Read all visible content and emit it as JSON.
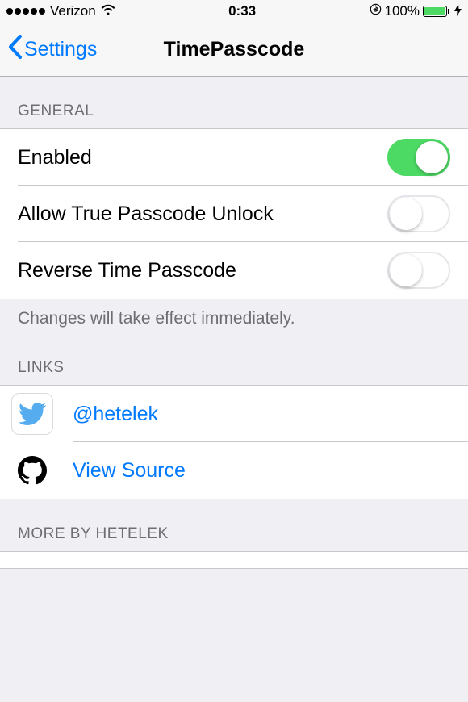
{
  "status_bar": {
    "carrier": "Verizon",
    "time": "0:33",
    "battery_percent": "100%"
  },
  "nav": {
    "back_label": "Settings",
    "title": "TimePasscode"
  },
  "sections": {
    "general": {
      "header": "GENERAL",
      "rows": {
        "enabled": {
          "label": "Enabled",
          "on": true
        },
        "allow_true": {
          "label": "Allow True Passcode Unlock",
          "on": false
        },
        "reverse": {
          "label": "Reverse Time Passcode",
          "on": false
        }
      },
      "footer": "Changes will take effect immediately."
    },
    "links": {
      "header": "LINKS",
      "twitter": {
        "label": "@hetelek"
      },
      "github": {
        "label": "View Source"
      }
    },
    "more": {
      "header": "MORE BY HETELEK"
    }
  }
}
